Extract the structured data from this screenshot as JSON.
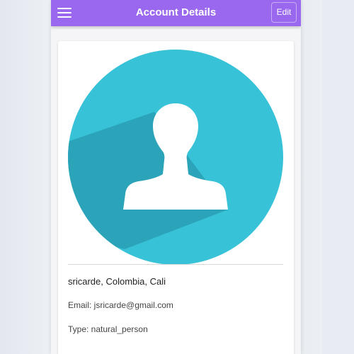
{
  "header": {
    "title": "Account Details",
    "edit_label": "Edit",
    "menu_icon": "hamburger-menu-icon"
  },
  "profile": {
    "avatar_icon": "user-avatar-icon",
    "name_location": "sricarde, Colombia, Cali",
    "email": "Email: jsricarde@gmail.com",
    "type": "Type: natural_person"
  },
  "colors": {
    "app_bar": "#9a68ee",
    "avatar_circle": "#38c2d8",
    "avatar_shadow": "#2ba3b8",
    "card": "#ffffff"
  }
}
